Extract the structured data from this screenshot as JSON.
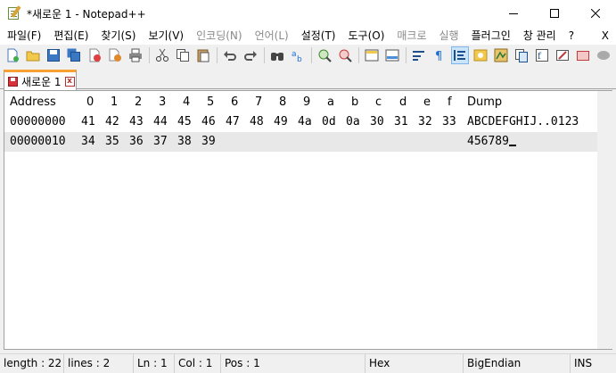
{
  "window": {
    "title": "*새로운 1 - Notepad++"
  },
  "menu": {
    "items": [
      {
        "label": "파일(F)",
        "disabled": false
      },
      {
        "label": "편집(E)",
        "disabled": false
      },
      {
        "label": "찾기(S)",
        "disabled": false
      },
      {
        "label": "보기(V)",
        "disabled": false
      },
      {
        "label": "인코딩(N)",
        "disabled": true
      },
      {
        "label": "언어(L)",
        "disabled": true
      },
      {
        "label": "설정(T)",
        "disabled": false
      },
      {
        "label": "도구(O)",
        "disabled": false
      },
      {
        "label": "매크로",
        "disabled": true
      },
      {
        "label": "실행",
        "disabled": true
      },
      {
        "label": "플러그인",
        "disabled": false
      },
      {
        "label": "창 관리",
        "disabled": false
      },
      {
        "label": "?",
        "disabled": false
      }
    ],
    "close_label": "X"
  },
  "tab": {
    "label": "새로운 1",
    "close_label": "x"
  },
  "hex_view": {
    "header": {
      "address": "Address",
      "columns": [
        "0",
        "1",
        "2",
        "3",
        "4",
        "5",
        "6",
        "7",
        "8",
        "9",
        "a",
        "b",
        "c",
        "d",
        "e",
        "f"
      ],
      "dump": "Dump"
    },
    "rows": [
      {
        "address": "00000000",
        "bytes": [
          "41",
          "42",
          "43",
          "44",
          "45",
          "46",
          "47",
          "48",
          "49",
          "4a",
          "0d",
          "0a",
          "30",
          "31",
          "32",
          "33"
        ],
        "dump": "ABCDEFGHIJ..0123"
      },
      {
        "address": "00000010",
        "bytes": [
          "34",
          "35",
          "36",
          "37",
          "38",
          "39"
        ],
        "dump": "456789"
      }
    ]
  },
  "status": {
    "length": "length : 22",
    "lines": "lines : 2",
    "ln": "Ln : 1",
    "col": "Col : 1",
    "pos": "Pos : 1",
    "mode": "Hex",
    "endian": "BigEndian",
    "ins": "INS"
  },
  "colors": {
    "tab_accent": "#f9a032",
    "selected_row": "#e8e8e8",
    "disabled_menu": "#8a8a8a"
  }
}
